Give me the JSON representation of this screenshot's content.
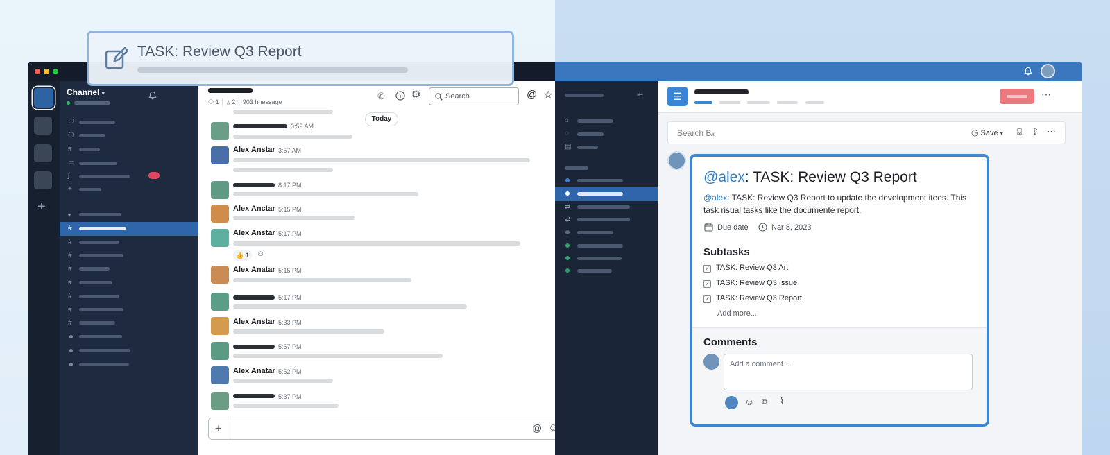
{
  "overlay_task": {
    "title": "TASK: Review Q3 Report"
  },
  "chat": {
    "workspace_menu": "Channel",
    "members_count": "1",
    "pinned_count": "2",
    "message_count": "903 hnessage",
    "search": {
      "placeholder": "Search"
    },
    "date_divider": "Today",
    "messages": [
      {
        "name": "",
        "time": "3:59 AM"
      },
      {
        "name": "Alex Anstar",
        "time": "3:57 AM"
      },
      {
        "name": "",
        "time": "8:17 PM"
      },
      {
        "name": "Alex Anctar",
        "time": "5:15 PM"
      },
      {
        "name": "Alex Anstar",
        "time": "5:17 PM",
        "reaction": "👍 1"
      },
      {
        "name": "Alex Anatar",
        "time": "5:15 PM"
      },
      {
        "name": "",
        "time": "5:17 PM"
      },
      {
        "name": "Alex Anstar",
        "time": "5:33 PM"
      },
      {
        "name": "",
        "time": "5:57 PM"
      },
      {
        "name": "Alex Anatar",
        "time": "5:52 PM"
      },
      {
        "name": "",
        "time": "5:37 PM"
      }
    ],
    "composer_add": "+"
  },
  "task_app": {
    "search": {
      "placeholder": "Search B𝓍"
    },
    "save_label": "Save",
    "detail": {
      "mention": "@alex",
      "title_rest": ": TASK: Review Q3 Report",
      "desc_mention": "@alex",
      "desc_line1": ": TASK: Review Q3 Report to update the development itees. This",
      "desc_line2": "task risual tasks like the documente report.",
      "due_label": "Due date",
      "due_value": "Nar 8, 2023",
      "subtasks_heading": "Subtasks",
      "subtasks": [
        {
          "label": "TASK: Review Q3 Art",
          "checked": true
        },
        {
          "label": "TASK: Review Q3 Issue",
          "checked": true
        },
        {
          "label": "TASK: Review Q3 Report",
          "checked": true
        }
      ],
      "add_more": "Add more...",
      "comments_heading": "Comments",
      "comment_placeholder": "Add a comment..."
    }
  },
  "colors": {
    "accent": "#3e87d0",
    "chat_sidebar": "#1d2a40",
    "selected": "#2f66ab",
    "badge": "#e0465e"
  },
  "icons": [
    "edit-icon",
    "bell-icon",
    "phone-icon",
    "info-icon",
    "gear-icon",
    "search-icon",
    "at-icon",
    "star-icon",
    "more-icon",
    "calendar-icon",
    "clock-icon",
    "bookmark-icon",
    "share-icon",
    "emoji-icon",
    "attach-icon",
    "list-icon"
  ]
}
